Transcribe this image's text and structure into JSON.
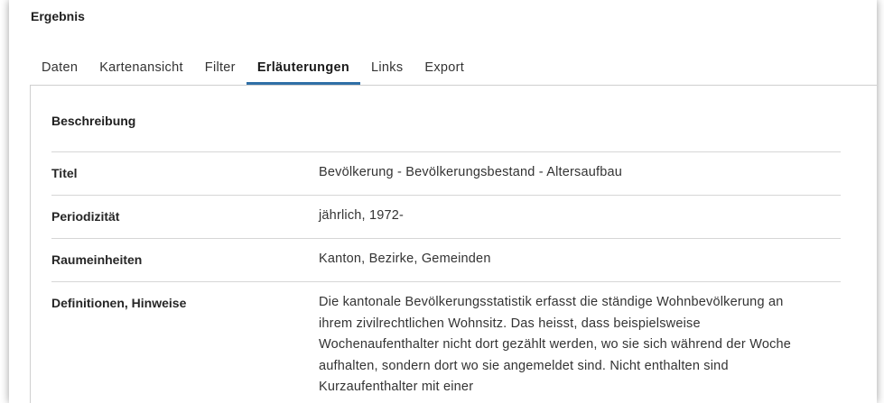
{
  "section": {
    "title": "Ergebnis"
  },
  "tabs": [
    {
      "label": "Daten"
    },
    {
      "label": "Kartenansicht"
    },
    {
      "label": "Filter"
    },
    {
      "label": "Erläuterungen"
    },
    {
      "label": "Links"
    },
    {
      "label": "Export"
    }
  ],
  "active_tab": "Erläuterungen",
  "panel": {
    "heading": "Beschreibung",
    "rows": [
      {
        "label": "Titel",
        "value": "Bevölkerung - Bevölkerungsbestand - Altersaufbau"
      },
      {
        "label": "Periodizität",
        "value": "jährlich, 1972-"
      },
      {
        "label": "Raumeinheiten",
        "value": "Kanton, Bezirke, Gemeinden"
      },
      {
        "label": "Definitionen, Hinweise",
        "value": "Die kantonale Bevölkerungsstatistik erfasst die ständige Wohnbevölkerung an ihrem zivilrechtlichen Wohnsitz. Das heisst, dass beispielsweise Wochenaufenthalter nicht dort gezählt werden, wo sie sich während der Woche aufhalten, sondern dort wo sie angemeldet sind. Nicht enthalten sind Kurzaufenthalter mit einer"
      }
    ]
  },
  "colors": {
    "active_tab_underline": "#2f6fa6",
    "divider": "#d6d6d6"
  }
}
